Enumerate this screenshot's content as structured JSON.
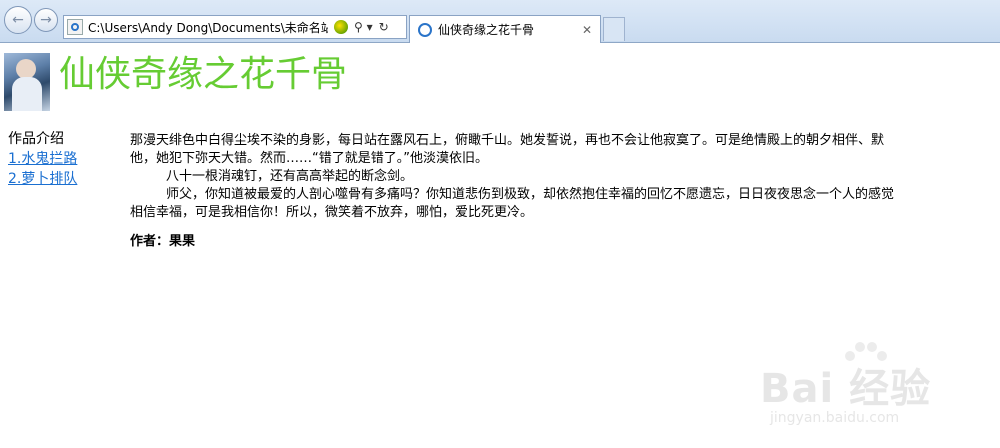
{
  "browser": {
    "address": "C:\\Users\\Andy Dong\\Documents\\未命名站点",
    "search_glyph": "⚲ ▾",
    "refresh_glyph": "↻",
    "tab_title": "仙侠奇缘之花千骨",
    "tab_close": "✕",
    "back_glyph": "←",
    "forward_glyph": "→"
  },
  "page": {
    "title": "仙侠奇缘之花千骨",
    "sidebar": {
      "heading": "作品介绍",
      "links": [
        "1.水鬼拦路",
        "2.萝卜排队"
      ]
    },
    "article": {
      "line1": "那漫天绯色中白得尘埃不染的身影，每日站在露风石上，俯瞰千山。她发誓说，再也不会让他寂寞了。可是绝情殿上的朝夕相伴、默",
      "line2": "他，她犯下弥天大错。然而……“错了就是错了。”他淡漠依旧。",
      "line3": "八十一根消魂钉，还有高高举起的断念剑。",
      "line4": "师父，你知道被最爱的人剖心噬骨有多痛吗？你知道悲伤到极致，却依然抱住幸福的回忆不愿遗忘，日日夜夜思念一个人的感觉",
      "line5": "相信幸福，可是我相信你！所以，微笑着不放弃，哪怕，爱比死更冷。",
      "author": "作者：果果"
    }
  },
  "watermark": {
    "brand": "Bai 经验",
    "url": "jingyan.baidu.com"
  }
}
